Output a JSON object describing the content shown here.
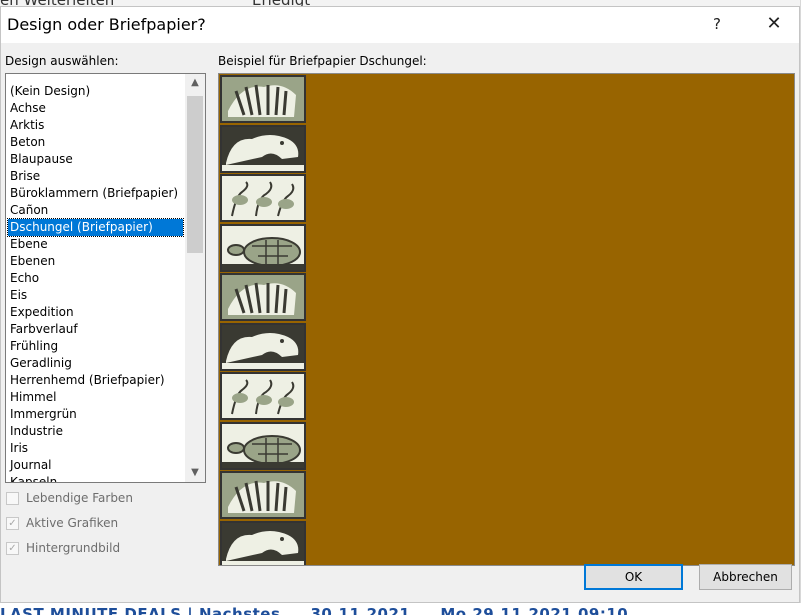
{
  "background": {
    "top_text": "en    Weiterleiten",
    "top_right_text": "Erledigt",
    "bottom_text": "LAST MINUTE DEALS | Nachstes ... 30.11.2021 ... Mo 29.11.2021 09:10"
  },
  "dialog": {
    "title": "Design oder Briefpapier?",
    "help_icon": "?",
    "close_icon": "✕"
  },
  "design_list": {
    "label": "Design auswählen:",
    "items": [
      "(Kein Design)",
      "Achse",
      "Arktis",
      "Beton",
      "Blaupause",
      "Brise",
      "Büroklammern (Briefpapier)",
      "Cañon",
      "Dschungel (Briefpapier)",
      "Ebene",
      "Ebenen",
      "Echo",
      "Eis",
      "Expedition",
      "Farbverlauf",
      "Frühling",
      "Geradlinig",
      "Herrenhemd (Briefpapier)",
      "Himmel",
      "Immergrün",
      "Industrie",
      "Iris",
      "Journal",
      "Kapseln"
    ],
    "selected": "Dschungel (Briefpapier)",
    "scroll_up_icon": "▲",
    "scroll_down_icon": "▼"
  },
  "options": {
    "lebendige_farben": {
      "label": "Lebendige Farben",
      "checked": false
    },
    "aktive_grafiken": {
      "label": "Aktive Grafiken",
      "checked": true
    },
    "hintergrundbild": {
      "label": "Hintergrundbild",
      "checked": true
    }
  },
  "preview": {
    "label": "Beispiel für Briefpapier Dschungel:",
    "background_color": "#986400",
    "tiles": [
      "zebra",
      "hippo",
      "flamingos",
      "turtle",
      "zebra",
      "hippo",
      "flamingos",
      "turtle",
      "zebra",
      "hippo"
    ]
  },
  "buttons": {
    "ok": "OK",
    "cancel": "Abbrechen"
  }
}
